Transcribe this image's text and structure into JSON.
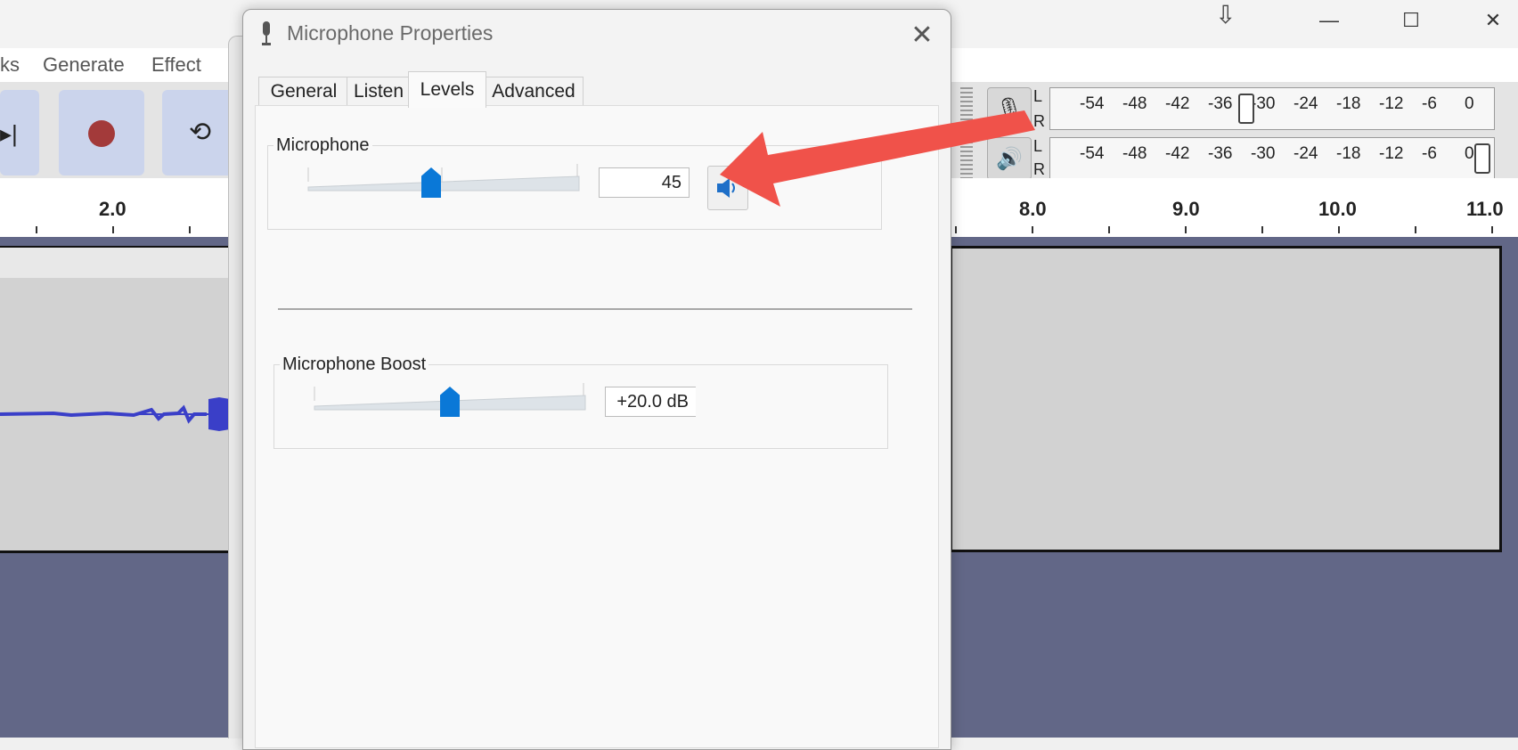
{
  "background_app": {
    "window_controls": {
      "minimize": "—",
      "maximize": "☐",
      "close": "✕"
    },
    "menu": [
      "ks",
      "Generate",
      "Effect"
    ],
    "ruler_labels": [
      "2.0",
      "8.0",
      "9.0",
      "10.0",
      "11.0"
    ],
    "meter": {
      "channel_top": "L",
      "channel_bottom": "R",
      "scale": [
        "-54",
        "-48",
        "-42",
        "-36",
        "-30",
        "-24",
        "-18",
        "-12",
        "-6",
        "0"
      ]
    }
  },
  "dialog": {
    "title": "Microphone Properties",
    "close": "✕",
    "tabs": [
      {
        "label": "General",
        "active": false
      },
      {
        "label": "Listen",
        "active": false
      },
      {
        "label": "Levels",
        "active": true
      },
      {
        "label": "Advanced",
        "active": false
      }
    ],
    "microphone": {
      "group_label": "Microphone",
      "value": "45",
      "level_percent": 45
    },
    "boost": {
      "group_label": "Microphone Boost",
      "value": "+20.0 dB",
      "level_fraction": 0.5
    }
  },
  "colors": {
    "accent": "#0a78d7",
    "annotation_arrow": "#f0524a",
    "track_bg": "#626787",
    "waveform": "#3a3fc8",
    "record": "#a33a3a"
  }
}
